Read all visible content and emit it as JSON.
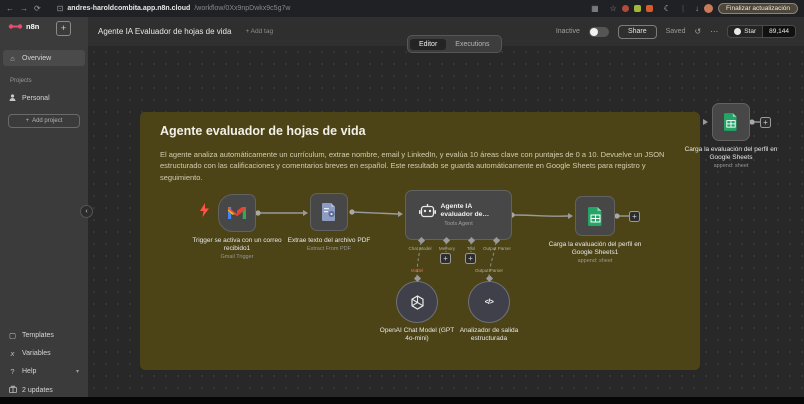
{
  "browser": {
    "url_domain": "andres-haroldcombita.app.n8n.cloud",
    "url_path": "/workflow/0Xx9npDwkx9c5g7w",
    "update_button_label": "Finalizar actualización"
  },
  "titlebar": {
    "workflow_title": "Agente IA Evaluador de hojas de vida",
    "add_tag_label": "+ Add tag",
    "inactive_label": "Inactive",
    "share_label": "Share",
    "saved_label": "Saved",
    "github_star_label": "Star",
    "github_star_count": "89,144"
  },
  "tabs": [
    {
      "label": "Editor",
      "active": true
    },
    {
      "label": "Executions",
      "active": false
    }
  ],
  "sidebar": {
    "brand": "n8n",
    "overview_label": "Overview",
    "projects_label": "Projects",
    "personal_label": "Personal",
    "add_project_label": "Add project",
    "templates_label": "Templates",
    "variables_label": "Variables",
    "help_label": "Help",
    "updates_label": "2 updates"
  },
  "note": {
    "title": "Agente evaluador de hojas de vida",
    "body": "El agente analiza automáticamente un currículum, extrae nombre, email y LinkedIn, y evalúa 10 áreas clave con puntajes de 0 a 10. Devuelve un JSON estructurado con las calificaciones y comentarios breves en español. Este resultado se guarda automáticamente en Google Sheets para registro y seguimiento."
  },
  "workflow": {
    "nodes": {
      "gmail_trigger": {
        "title": "Trigger se activa con un correo recibido1",
        "subtitle": "Gmail Trigger"
      },
      "extract_pdf": {
        "title": "Extrae texto del archivo PDF",
        "subtitle": "Extract From PDF"
      },
      "ai_agent": {
        "title": "Agente IA evaluador de…",
        "subtitle": "Tools Agent",
        "ports": [
          "Chat Model",
          "Memory",
          "Tool",
          "Output Parser"
        ]
      },
      "google_sheets_1": {
        "title": "Carga la evaluación del perfil en Google Sheets1",
        "subtitle": "append: sheet"
      },
      "openai_model": {
        "title": "OpenAI Chat Model (GPT 4o-mini)",
        "port_label": "Model"
      },
      "output_parser": {
        "title": "Analizador de salida estructurada",
        "port_label": "Output Parser"
      },
      "google_sheets_detached": {
        "title": "Carga la evaluación del perfil en Google Sheets",
        "subtitle": "append: sheet"
      }
    }
  },
  "colors": {
    "accent_pink": "#ea4b71",
    "note_bg": "#4c4416",
    "sheets_green": "#23a566",
    "trigger_bolt": "#ff5347",
    "gmail_red": "#ea4335",
    "gmail_blue": "#4285f4",
    "gmail_green": "#34a853",
    "gmail_yellow": "#fbbc04"
  }
}
